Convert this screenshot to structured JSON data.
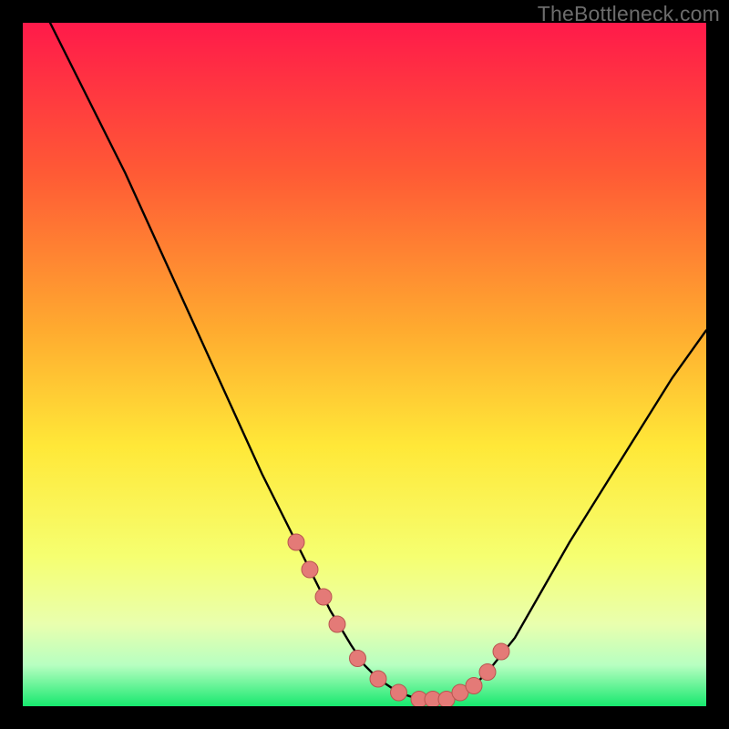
{
  "watermark": "TheBottleneck.com",
  "colors": {
    "background": "#000000",
    "gradient_top": "#ff1a4a",
    "gradient_upper_mid": "#ff8a2a",
    "gradient_mid": "#ffe838",
    "gradient_lower_mid": "#f6ff70",
    "gradient_low": "#caffb0",
    "gradient_bottom": "#17e86e",
    "curve": "#000000",
    "marker_fill": "#e47a77",
    "marker_stroke": "#b85550"
  },
  "chart_data": {
    "type": "line",
    "title": "",
    "xlabel": "",
    "ylabel": "",
    "xlim": [
      0,
      100
    ],
    "ylim": [
      0,
      100
    ],
    "grid": false,
    "legend": false,
    "series": [
      {
        "name": "bottleneck-curve",
        "x": [
          0,
          5,
          10,
          15,
          20,
          25,
          30,
          35,
          40,
          45,
          48,
          50,
          52,
          55,
          58,
          60,
          62,
          65,
          68,
          72,
          76,
          80,
          85,
          90,
          95,
          100
        ],
        "y": [
          108,
          98,
          88,
          78,
          67,
          56,
          45,
          34,
          24,
          14,
          9,
          6,
          4,
          2,
          1,
          1,
          1,
          2,
          5,
          10,
          17,
          24,
          32,
          40,
          48,
          55
        ]
      }
    ],
    "markers": {
      "name": "highlighted-points",
      "x": [
        40,
        42,
        44,
        46,
        49,
        52,
        55,
        58,
        60,
        62,
        64,
        66,
        68,
        70
      ],
      "y": [
        24,
        20,
        16,
        12,
        7,
        4,
        2,
        1,
        1,
        1,
        2,
        3,
        5,
        8
      ]
    }
  }
}
